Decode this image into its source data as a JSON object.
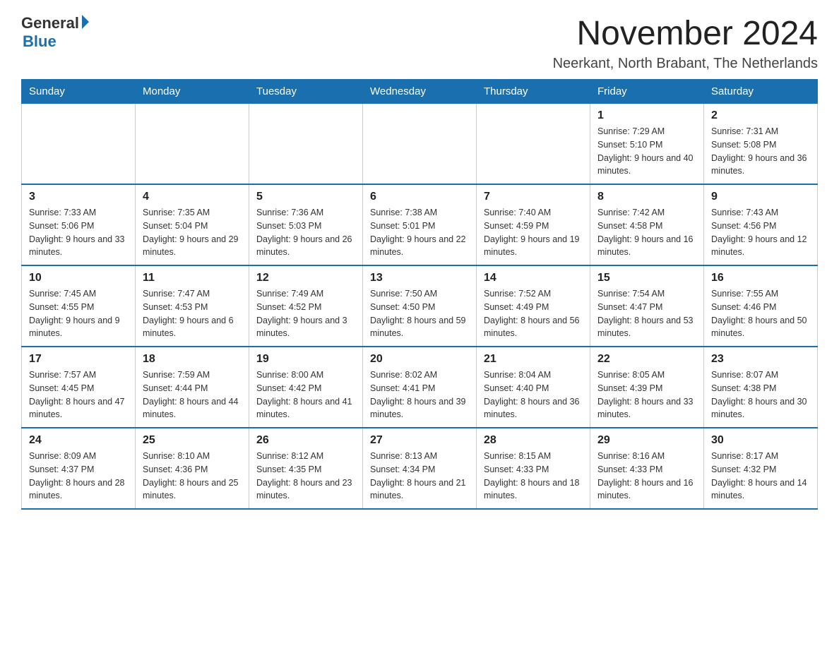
{
  "logo": {
    "general": "General",
    "blue": "Blue"
  },
  "title": "November 2024",
  "location": "Neerkant, North Brabant, The Netherlands",
  "days_of_week": [
    "Sunday",
    "Monday",
    "Tuesday",
    "Wednesday",
    "Thursday",
    "Friday",
    "Saturday"
  ],
  "weeks": [
    [
      {
        "day": "",
        "detail": ""
      },
      {
        "day": "",
        "detail": ""
      },
      {
        "day": "",
        "detail": ""
      },
      {
        "day": "",
        "detail": ""
      },
      {
        "day": "",
        "detail": ""
      },
      {
        "day": "1",
        "detail": "Sunrise: 7:29 AM\nSunset: 5:10 PM\nDaylight: 9 hours and 40 minutes."
      },
      {
        "day": "2",
        "detail": "Sunrise: 7:31 AM\nSunset: 5:08 PM\nDaylight: 9 hours and 36 minutes."
      }
    ],
    [
      {
        "day": "3",
        "detail": "Sunrise: 7:33 AM\nSunset: 5:06 PM\nDaylight: 9 hours and 33 minutes."
      },
      {
        "day": "4",
        "detail": "Sunrise: 7:35 AM\nSunset: 5:04 PM\nDaylight: 9 hours and 29 minutes."
      },
      {
        "day": "5",
        "detail": "Sunrise: 7:36 AM\nSunset: 5:03 PM\nDaylight: 9 hours and 26 minutes."
      },
      {
        "day": "6",
        "detail": "Sunrise: 7:38 AM\nSunset: 5:01 PM\nDaylight: 9 hours and 22 minutes."
      },
      {
        "day": "7",
        "detail": "Sunrise: 7:40 AM\nSunset: 4:59 PM\nDaylight: 9 hours and 19 minutes."
      },
      {
        "day": "8",
        "detail": "Sunrise: 7:42 AM\nSunset: 4:58 PM\nDaylight: 9 hours and 16 minutes."
      },
      {
        "day": "9",
        "detail": "Sunrise: 7:43 AM\nSunset: 4:56 PM\nDaylight: 9 hours and 12 minutes."
      }
    ],
    [
      {
        "day": "10",
        "detail": "Sunrise: 7:45 AM\nSunset: 4:55 PM\nDaylight: 9 hours and 9 minutes."
      },
      {
        "day": "11",
        "detail": "Sunrise: 7:47 AM\nSunset: 4:53 PM\nDaylight: 9 hours and 6 minutes."
      },
      {
        "day": "12",
        "detail": "Sunrise: 7:49 AM\nSunset: 4:52 PM\nDaylight: 9 hours and 3 minutes."
      },
      {
        "day": "13",
        "detail": "Sunrise: 7:50 AM\nSunset: 4:50 PM\nDaylight: 8 hours and 59 minutes."
      },
      {
        "day": "14",
        "detail": "Sunrise: 7:52 AM\nSunset: 4:49 PM\nDaylight: 8 hours and 56 minutes."
      },
      {
        "day": "15",
        "detail": "Sunrise: 7:54 AM\nSunset: 4:47 PM\nDaylight: 8 hours and 53 minutes."
      },
      {
        "day": "16",
        "detail": "Sunrise: 7:55 AM\nSunset: 4:46 PM\nDaylight: 8 hours and 50 minutes."
      }
    ],
    [
      {
        "day": "17",
        "detail": "Sunrise: 7:57 AM\nSunset: 4:45 PM\nDaylight: 8 hours and 47 minutes."
      },
      {
        "day": "18",
        "detail": "Sunrise: 7:59 AM\nSunset: 4:44 PM\nDaylight: 8 hours and 44 minutes."
      },
      {
        "day": "19",
        "detail": "Sunrise: 8:00 AM\nSunset: 4:42 PM\nDaylight: 8 hours and 41 minutes."
      },
      {
        "day": "20",
        "detail": "Sunrise: 8:02 AM\nSunset: 4:41 PM\nDaylight: 8 hours and 39 minutes."
      },
      {
        "day": "21",
        "detail": "Sunrise: 8:04 AM\nSunset: 4:40 PM\nDaylight: 8 hours and 36 minutes."
      },
      {
        "day": "22",
        "detail": "Sunrise: 8:05 AM\nSunset: 4:39 PM\nDaylight: 8 hours and 33 minutes."
      },
      {
        "day": "23",
        "detail": "Sunrise: 8:07 AM\nSunset: 4:38 PM\nDaylight: 8 hours and 30 minutes."
      }
    ],
    [
      {
        "day": "24",
        "detail": "Sunrise: 8:09 AM\nSunset: 4:37 PM\nDaylight: 8 hours and 28 minutes."
      },
      {
        "day": "25",
        "detail": "Sunrise: 8:10 AM\nSunset: 4:36 PM\nDaylight: 8 hours and 25 minutes."
      },
      {
        "day": "26",
        "detail": "Sunrise: 8:12 AM\nSunset: 4:35 PM\nDaylight: 8 hours and 23 minutes."
      },
      {
        "day": "27",
        "detail": "Sunrise: 8:13 AM\nSunset: 4:34 PM\nDaylight: 8 hours and 21 minutes."
      },
      {
        "day": "28",
        "detail": "Sunrise: 8:15 AM\nSunset: 4:33 PM\nDaylight: 8 hours and 18 minutes."
      },
      {
        "day": "29",
        "detail": "Sunrise: 8:16 AM\nSunset: 4:33 PM\nDaylight: 8 hours and 16 minutes."
      },
      {
        "day": "30",
        "detail": "Sunrise: 8:17 AM\nSunset: 4:32 PM\nDaylight: 8 hours and 14 minutes."
      }
    ]
  ]
}
